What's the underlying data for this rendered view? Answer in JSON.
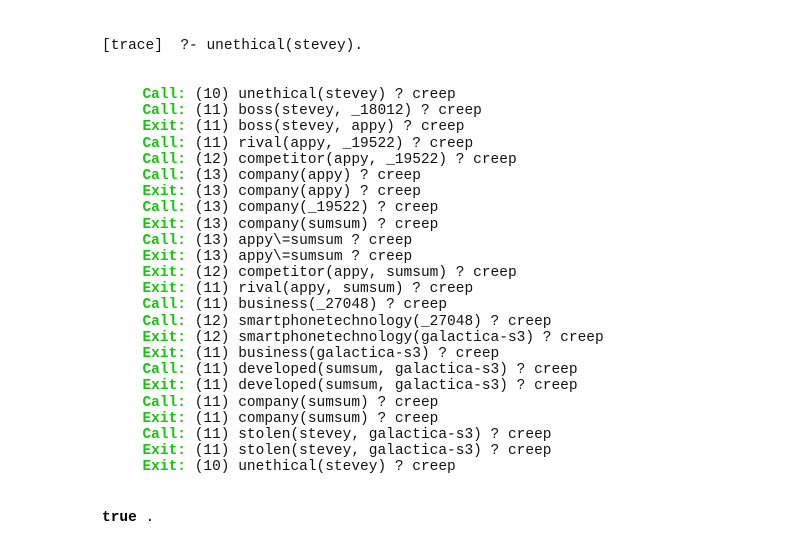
{
  "query": {
    "prompt_label": "[trace]",
    "prompt_symbol": "?-",
    "goal": "unethical(stevey)."
  },
  "trace": [
    {
      "port": "Call:",
      "depth": "(10)",
      "goal": "unethical(stevey) ? creep"
    },
    {
      "port": "Call:",
      "depth": "(11)",
      "goal": "boss(stevey, _18012) ? creep"
    },
    {
      "port": "Exit:",
      "depth": "(11)",
      "goal": "boss(stevey, appy) ? creep"
    },
    {
      "port": "Call:",
      "depth": "(11)",
      "goal": "rival(appy, _19522) ? creep"
    },
    {
      "port": "Call:",
      "depth": "(12)",
      "goal": "competitor(appy, _19522) ? creep"
    },
    {
      "port": "Call:",
      "depth": "(13)",
      "goal": "company(appy) ? creep"
    },
    {
      "port": "Exit:",
      "depth": "(13)",
      "goal": "company(appy) ? creep"
    },
    {
      "port": "Call:",
      "depth": "(13)",
      "goal": "company(_19522) ? creep"
    },
    {
      "port": "Exit:",
      "depth": "(13)",
      "goal": "company(sumsum) ? creep"
    },
    {
      "port": "Call:",
      "depth": "(13)",
      "goal": "appy\\=sumsum ? creep"
    },
    {
      "port": "Exit:",
      "depth": "(13)",
      "goal": "appy\\=sumsum ? creep"
    },
    {
      "port": "Exit:",
      "depth": "(12)",
      "goal": "competitor(appy, sumsum) ? creep"
    },
    {
      "port": "Exit:",
      "depth": "(11)",
      "goal": "rival(appy, sumsum) ? creep"
    },
    {
      "port": "Call:",
      "depth": "(11)",
      "goal": "business(_27048) ? creep"
    },
    {
      "port": "Call:",
      "depth": "(12)",
      "goal": "smartphonetechnology(_27048) ? creep"
    },
    {
      "port": "Exit:",
      "depth": "(12)",
      "goal": "smartphonetechnology(galactica-s3) ? creep"
    },
    {
      "port": "Exit:",
      "depth": "(11)",
      "goal": "business(galactica-s3) ? creep"
    },
    {
      "port": "Call:",
      "depth": "(11)",
      "goal": "developed(sumsum, galactica-s3) ? creep"
    },
    {
      "port": "Exit:",
      "depth": "(11)",
      "goal": "developed(sumsum, galactica-s3) ? creep"
    },
    {
      "port": "Call:",
      "depth": "(11)",
      "goal": "company(sumsum) ? creep"
    },
    {
      "port": "Exit:",
      "depth": "(11)",
      "goal": "company(sumsum) ? creep"
    },
    {
      "port": "Call:",
      "depth": "(11)",
      "goal": "stolen(stevey, galactica-s3) ? creep"
    },
    {
      "port": "Exit:",
      "depth": "(11)",
      "goal": "stolen(stevey, galactica-s3) ? creep"
    },
    {
      "port": "Exit:",
      "depth": "(10)",
      "goal": "unethical(stevey) ? creep"
    }
  ],
  "result": {
    "value": "true",
    "terminator": "."
  },
  "colors": {
    "port": "#16c60c",
    "text": "#111111",
    "background": "#ffffff"
  }
}
